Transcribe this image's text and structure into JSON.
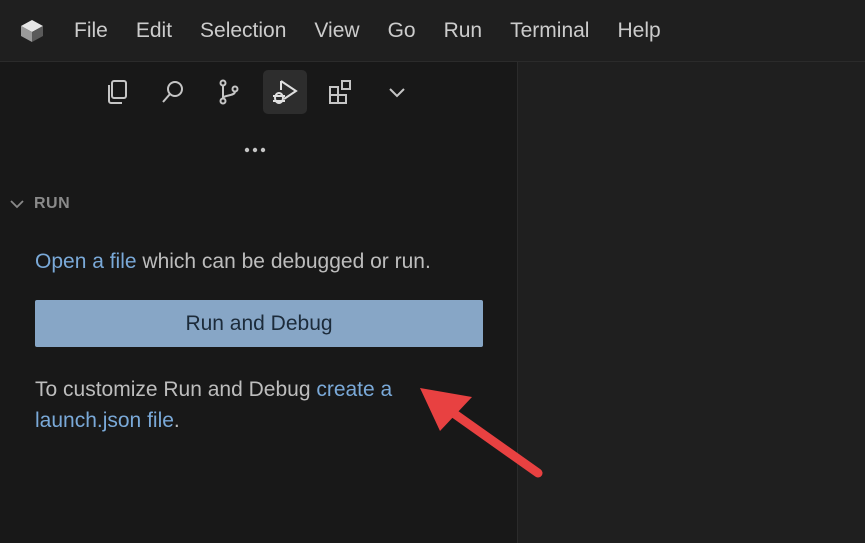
{
  "menu": {
    "items": [
      "File",
      "Edit",
      "Selection",
      "View",
      "Go",
      "Run",
      "Terminal",
      "Help"
    ]
  },
  "activity_bar": {
    "icons": [
      "explorer-icon",
      "search-icon",
      "source-control-icon",
      "run-debug-icon",
      "extensions-icon",
      "chevron-down-icon"
    ],
    "active": "run-debug-icon",
    "more": "..."
  },
  "run_panel": {
    "section_title": "RUN",
    "open_link": "Open a file",
    "open_rest": " which can be debugged or run.",
    "run_button_label": "Run and Debug",
    "customize_prefix": "To customize Run and Debug ",
    "customize_link": "create a launch.json file",
    "customize_suffix": "."
  },
  "colors": {
    "accent_link": "#7aa9d8",
    "button_bg": "#87a6c6",
    "arrow": "#e84141"
  }
}
